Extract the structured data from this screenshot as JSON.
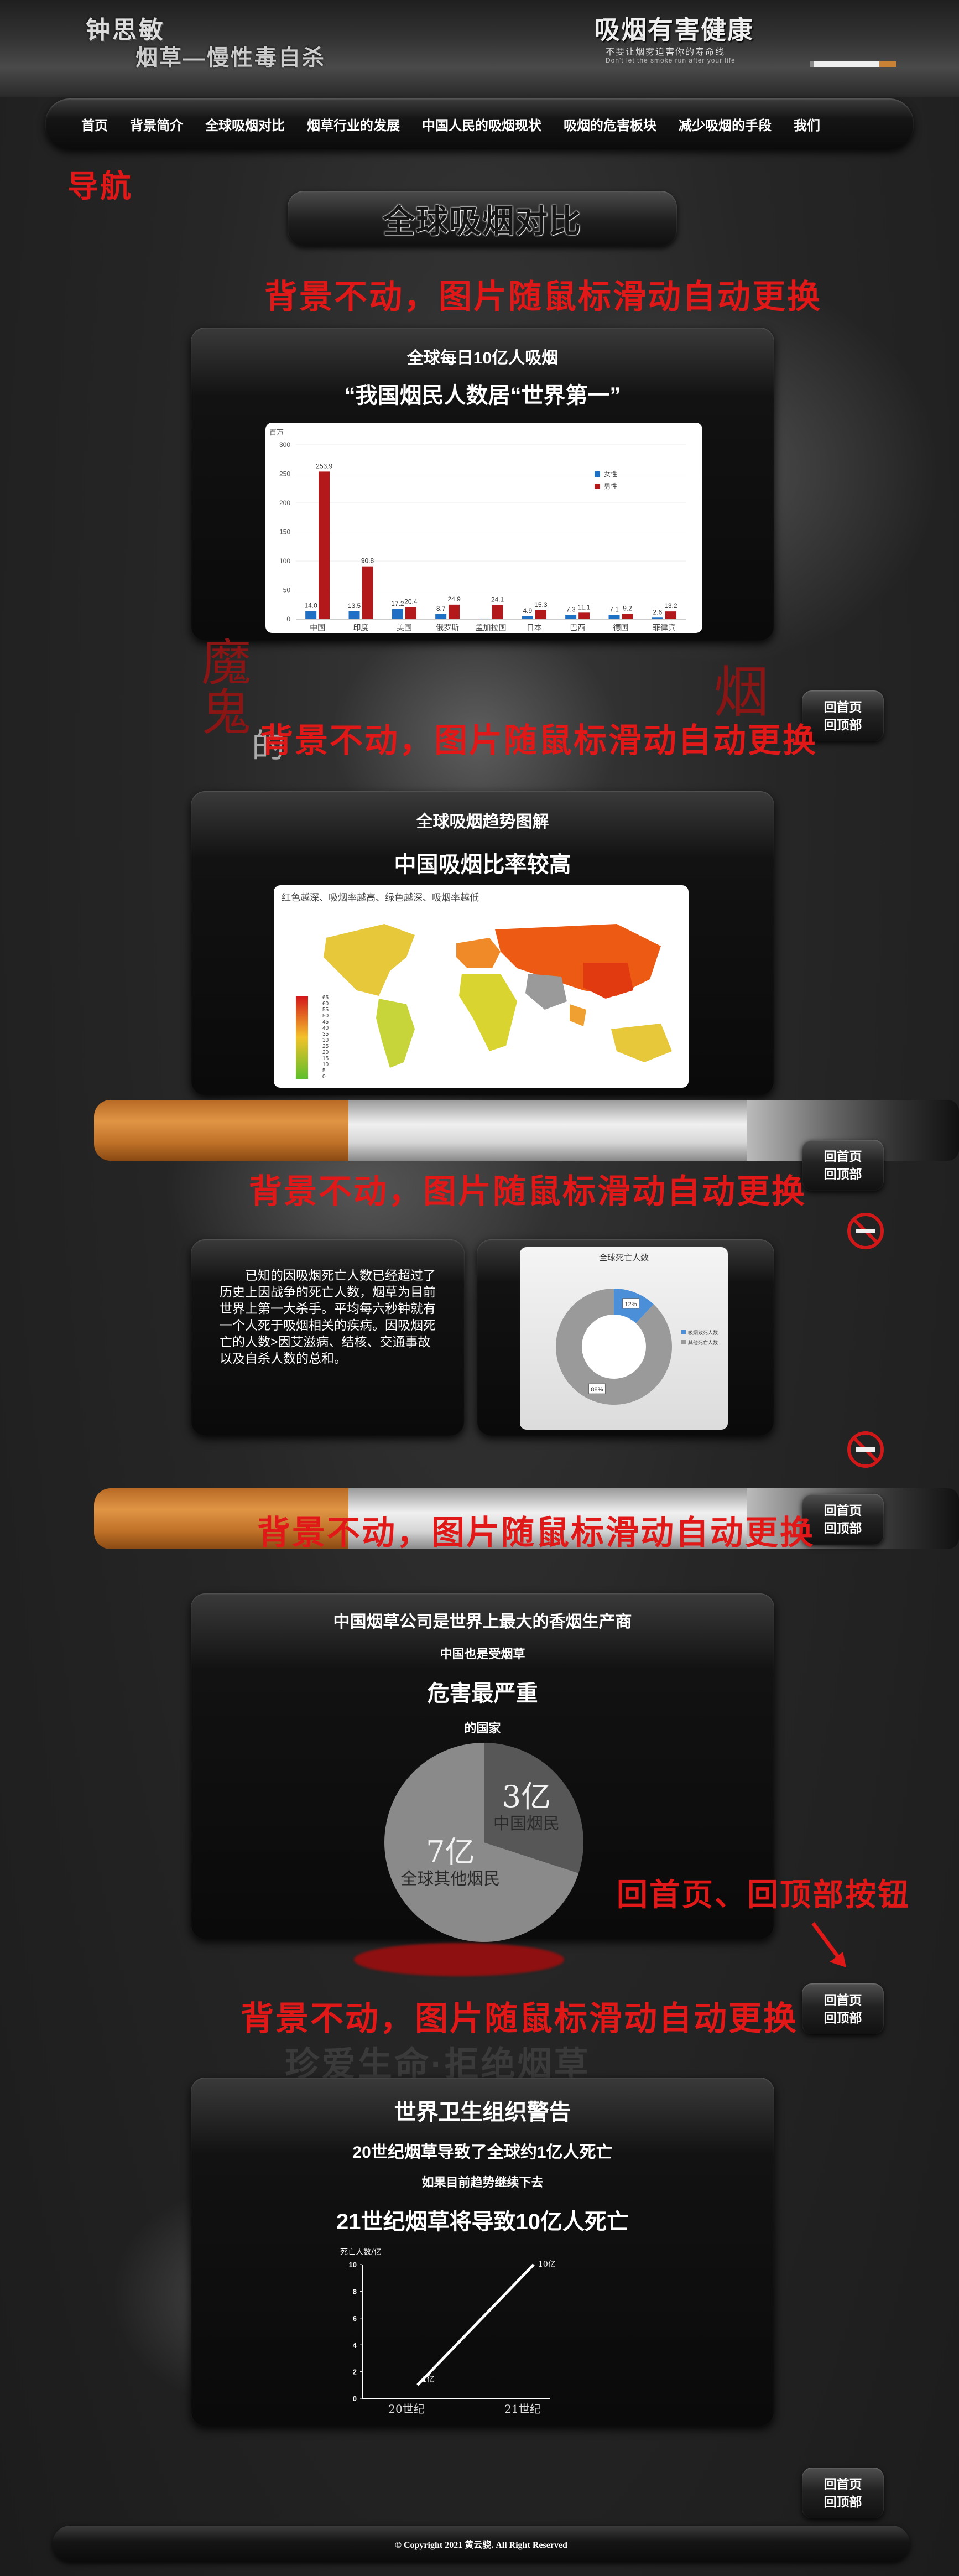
{
  "header": {
    "logo_line1": "钟思敏",
    "logo_line2": "烟草—慢性毒自杀",
    "slogan_title": "吸烟有害健康",
    "slogan_sub1": "不要让烟雾迫害你的寿命线",
    "slogan_sub2": "Don't let the smoke run after your life"
  },
  "nav": {
    "items": [
      "首页",
      "背景简介",
      "全球吸烟对比",
      "烟草行业的发展",
      "中国人民的吸烟现状",
      "吸烟的危害板块",
      "减少吸烟的手段",
      "我们"
    ]
  },
  "annotations": {
    "nav": "导航",
    "bg_static": "背景不动，图片随鼠标滑动自动更换",
    "back_buttons": "回首页、回顶部按钮"
  },
  "page_title": "全球吸烟对比",
  "back_button": {
    "home": "回首页",
    "top": "回顶部"
  },
  "decor": {
    "calligraphy_left": "魔鬼",
    "calligraphy_right": "烟",
    "calligraphy_mid": "的",
    "bg_slogan": "珍爱生命·拒绝烟草"
  },
  "section1": {
    "heading": "全球每日10亿人吸烟",
    "subheading": "“我国烟民人数居“世界第一”"
  },
  "section2": {
    "heading": "全球吸烟趋势图解",
    "subheading": "中国吸烟比率较高",
    "map_caption": "红色越深、吸烟率越高、绿色越深、吸烟率越低",
    "legend_values": [
      "65",
      "60",
      "55",
      "50",
      "45",
      "40",
      "35",
      "30",
      "25",
      "20",
      "15",
      "10",
      "5",
      "0"
    ]
  },
  "section3": {
    "text": "已知的因吸烟死亡人数已经超过了历史上因战争的死亡人数，烟草为目前世界上第一大杀手。平均每六秒钟就有一个人死于吸烟相关的疾病。因吸烟死亡的人数>因艾滋病、结核、交通事故以及自杀人数的总和。"
  },
  "section4": {
    "heading": "中国烟草公司是世界上最大的香烟生产商",
    "sub1": "中国也是受烟草",
    "sub2": "危害最严重",
    "sub3": "的国家"
  },
  "section5": {
    "heading": "世界卫生组织警告",
    "line1": "20世纪烟草导致了全球约1亿人死亡",
    "line2": "如果目前趋势继续下去",
    "line3": "21世纪烟草将导致10亿人死亡"
  },
  "footer": {
    "copyright": "© Copyright 2021 黄云骁. All Right Reserved"
  },
  "chart_data": [
    {
      "type": "bar",
      "ylabel": "百万",
      "ylim": [
        0,
        300
      ],
      "yticks": [
        "300",
        "250",
        "200",
        "150",
        "100",
        "50",
        "0"
      ],
      "categories": [
        "中国",
        "印度",
        "美国",
        "俄罗斯",
        "孟加拉国",
        "日本",
        "巴西",
        "德国",
        "菲律宾"
      ],
      "series": [
        {
          "name": "女性",
          "color": "#1f6fc5",
          "values": [
            14.0,
            13.5,
            17.2,
            8.7,
            1,
            4.9,
            7.3,
            7.1,
            2.6
          ]
        },
        {
          "name": "男性",
          "color": "#b3181a",
          "values": [
            253.9,
            90.8,
            20.4,
            24.9,
            24.1,
            15.3,
            11.1,
            9.2,
            13.2
          ]
        }
      ],
      "data_labels_female": [
        "14.0",
        "13.5",
        "17.2",
        "8.7",
        "",
        "4.9",
        "7.3",
        "7.1",
        "2.6"
      ],
      "data_labels_male": [
        "253.9",
        "90.8",
        "20.4",
        "24.9",
        "24.1",
        "15.3",
        "11.1",
        "9.2",
        "13.2"
      ],
      "legend_position": "top-right"
    },
    {
      "type": "pie",
      "title": "全球死亡人数",
      "style": "donut",
      "slices": [
        {
          "name": "吸烟致死人数",
          "value": 12,
          "label": "12%",
          "color": "#4a8fd8"
        },
        {
          "name": "其他死亡人数",
          "value": 88,
          "label": "88%",
          "color": "#9a9a9a"
        }
      ],
      "legend_position": "right"
    },
    {
      "type": "pie",
      "slices": [
        {
          "name": "中国烟民",
          "value": 3,
          "label": "3亿",
          "color": "#575757"
        },
        {
          "name": "全球其他烟民",
          "value": 7,
          "label": "7亿",
          "color": "#8a8a8a"
        }
      ]
    },
    {
      "type": "line",
      "ylabel": "死亡人数/亿",
      "ylim": [
        0,
        10
      ],
      "yticks": [
        "10",
        "8",
        "6",
        "4",
        "2",
        "0"
      ],
      "categories": [
        "20世纪",
        "21世纪"
      ],
      "values": [
        1,
        10
      ],
      "point_labels": [
        "1亿",
        "10亿"
      ]
    }
  ]
}
